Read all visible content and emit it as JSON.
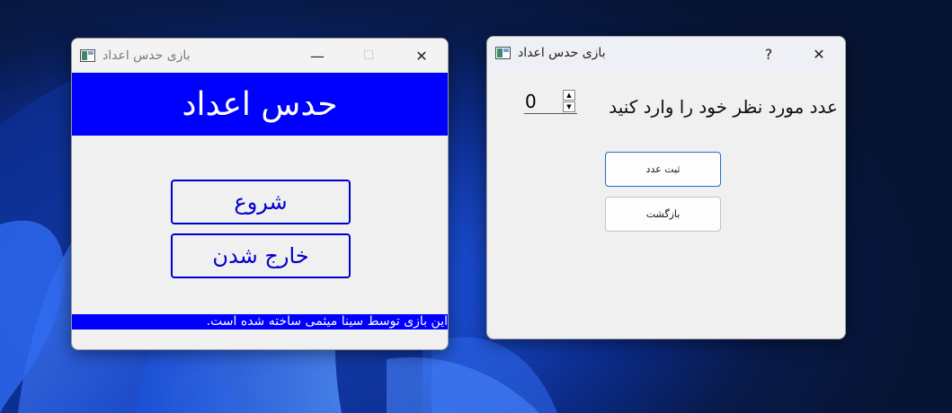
{
  "desktop": {
    "wallpaper": "windows-11-bloom"
  },
  "main_window": {
    "title": "بازی حدس اعداد",
    "controls": {
      "minimize": "—",
      "maximize": "☐",
      "close": "✕"
    },
    "header": "حدس اعداد",
    "buttons": {
      "start": "شروع",
      "exit": "خارج شدن"
    },
    "footer": "این بازی توسط سینا میثمی ساخته شده است."
  },
  "dialog_window": {
    "title": "بازی حدس اعداد",
    "controls": {
      "help": "?",
      "close": "✕"
    },
    "prompt": "عدد مورد نظر خود را وارد کنید",
    "number_input": {
      "value": "0"
    },
    "buttons": {
      "submit": "ثبت عدد",
      "back": "بازگشت"
    }
  },
  "colors": {
    "accent_blue": "#0000ff",
    "button_border": "#0000cc",
    "focus_border": "#1f6fc2"
  }
}
